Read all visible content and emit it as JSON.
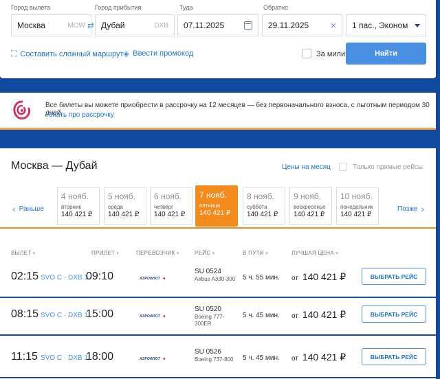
{
  "search": {
    "from_label": "Город вылета",
    "from_value": "Москва",
    "from_code": "MOW",
    "to_label": "Город прибытия",
    "to_value": "Дубай",
    "to_code": "DXB",
    "depart_label": "Туда",
    "depart_value": "07.11.2025",
    "return_label": "Обратно",
    "return_value": "29.11.2025",
    "passengers_value": "1 пас., Эконом",
    "complex_route_link": "Составить сложный маршрут",
    "promo_code_link": "Ввести промокод",
    "miles_label": "За мили",
    "find_button": "Найти"
  },
  "promo": {
    "text": "Все билеты вы можете приобрести в рассрочку на 12 месяцев — без первоначального взноса, с льготным периодом 30 дней.",
    "link": "Узнать про рассрочку"
  },
  "results": {
    "route_title": "Москва — Дубай",
    "month_prices_link": "Цены на месяц",
    "direct_only_label": "Только прямые рейсы",
    "prev_label": "Раньше",
    "next_label": "Позже",
    "days": [
      {
        "date": "4 нояб.",
        "weekday": "вторник",
        "price": "140 421 ₽",
        "active": false
      },
      {
        "date": "5 нояб.",
        "weekday": "среда",
        "price": "140 421 ₽",
        "active": false
      },
      {
        "date": "6 нояб.",
        "weekday": "четверг",
        "price": "140 421 ₽",
        "active": false
      },
      {
        "date": "7 нояб.",
        "weekday": "пятница",
        "price": "140 421 ₽",
        "active": true
      },
      {
        "date": "8 нояб.",
        "weekday": "суббота",
        "price": "140 421 ₽",
        "active": false
      },
      {
        "date": "9 нояб.",
        "weekday": "воскресенье",
        "price": "140 421 ₽",
        "active": false
      },
      {
        "date": "10 нояб.",
        "weekday": "понедельник",
        "price": "140 421 ₽",
        "active": false
      }
    ],
    "columns": {
      "departure": "ВЫЛЕТ",
      "arrival": "ПРИЛЕТ",
      "carrier": "ПЕРЕВОЗЧИК",
      "flight": "РЕЙС",
      "duration": "В ПУТИ",
      "best_price": "ЛУЧШАЯ ЦЕНА"
    },
    "flights": [
      {
        "dep": "02:15",
        "airports": "SVO C · DXB 1",
        "arr": "09:10",
        "carrier": "АЭРОФЛОТ",
        "flight_no": "SU 0524",
        "aircraft": "Airbus A330-300",
        "duration": "5 ч. 55 мин.",
        "price_prefix": "от",
        "price": "140 421 ₽",
        "select": "ВЫБРАТЬ РЕЙС"
      },
      {
        "dep": "08:15",
        "airports": "SVO C · DXB 1",
        "arr": "15:00",
        "carrier": "АЭРОФЛОТ",
        "flight_no": "SU 0520",
        "aircraft": "Boeing 777-300ER",
        "duration": "5 ч. 45 мин.",
        "price_prefix": "от",
        "price": "140 421 ₽",
        "select": "ВЫБРАТЬ РЕЙС"
      },
      {
        "dep": "11:15",
        "airports": "SVO C · DXB 1",
        "arr": "18:00",
        "carrier": "АЭРОФЛОТ",
        "flight_no": "SU 0526",
        "aircraft": "Boeing 737-800",
        "duration": "5 ч. 45 мин.",
        "price_prefix": "от",
        "price": "140 421 ₽",
        "select": "ВЫБРАТЬ РЕЙС"
      }
    ]
  }
}
